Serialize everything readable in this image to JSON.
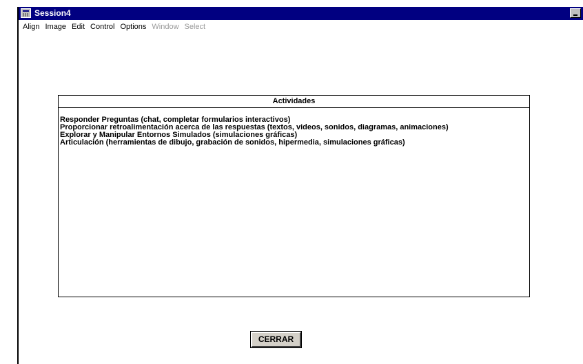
{
  "window": {
    "title": "Session4"
  },
  "menubar": {
    "items": [
      {
        "label": "Align",
        "enabled": true
      },
      {
        "label": "Image",
        "enabled": true
      },
      {
        "label": "Edit",
        "enabled": true
      },
      {
        "label": "Control",
        "enabled": true
      },
      {
        "label": "Options",
        "enabled": true
      },
      {
        "label": "Window",
        "enabled": false
      },
      {
        "label": "Select",
        "enabled": false
      }
    ]
  },
  "panel": {
    "header": "Actividades",
    "lines": [
      "Responder Preguntas (chat, completar formularios interactivos)",
      "Proporcionar retroalimentación acerca de las respuestas (textos, videos, sonidos, diagramas, animaciones)",
      "Explorar y Manipular Entornos Simulados (simulaciones gráficas)",
      "Articulación (herramientas de dibujo, grabación de sonidos, hipermedia, simulaciones gráficas)"
    ]
  },
  "close_button": {
    "label": "CERRAR"
  },
  "colors": {
    "titlebar": "#010081",
    "background": "#ffffff",
    "button_face": "#d4d0c8"
  }
}
